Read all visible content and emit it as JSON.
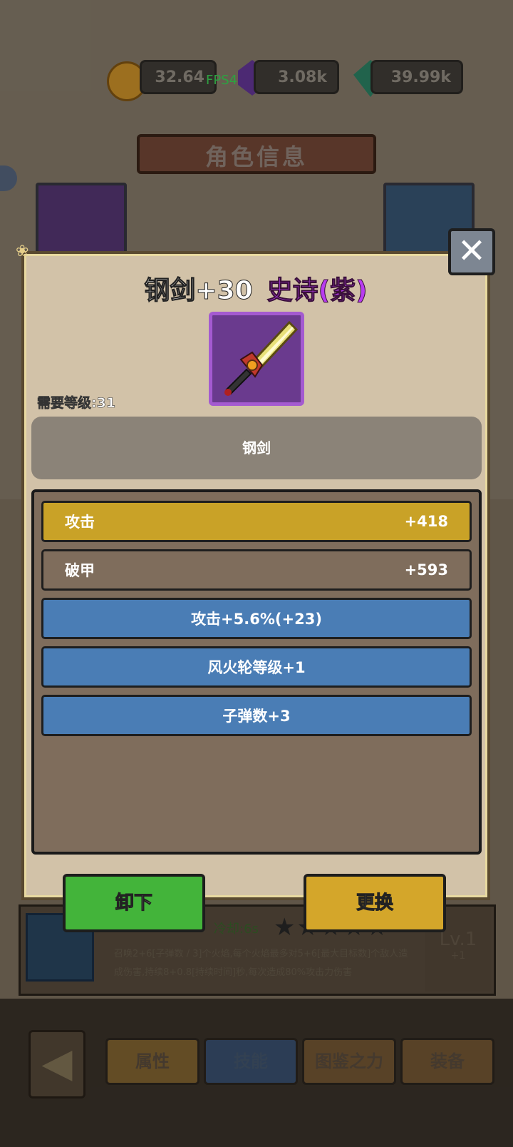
{
  "hud": {
    "gold": "32.64",
    "fps": "FPS49",
    "purple_gem": "3.08k",
    "green_gem": "39.99k"
  },
  "screen_title": "角色信息",
  "item": {
    "name": "钢剑+30",
    "rarity": "史诗(紫)",
    "rarity_color": "#b83cf0",
    "required_level": "需要等级:31",
    "base_name": "钢剑",
    "icon": "sword-icon"
  },
  "stats": [
    {
      "label": "攻击",
      "value": "+418",
      "color": "#c9a227"
    },
    {
      "label": "破甲",
      "value": "+593",
      "color": "#7f6d5c"
    }
  ],
  "bonuses": [
    {
      "text": "攻击+5.6%(+23)",
      "color": "#4a7db5"
    },
    {
      "text": "风火轮等级+1",
      "color": "#4a7db5"
    },
    {
      "text": "子弹数+3",
      "color": "#4a7db5"
    }
  ],
  "buttons": {
    "unequip": "卸下",
    "replace": "更换",
    "unequip_color": "#43b43a",
    "replace_color": "#d4a62a"
  },
  "skill": {
    "cooldown": "冷却:6s",
    "desc": "召唤2+6[子弹数 / 3]个火焰,每个火焰最多对5+6[最大目标数]个敌人造成伤害,持续8+0.8[持续时间]秒,每次造成80%攻击力伤害",
    "level": "Lv.1",
    "level_sub": "+1"
  },
  "tabs": [
    "属性",
    "技能",
    "图鉴之力",
    "装备"
  ]
}
